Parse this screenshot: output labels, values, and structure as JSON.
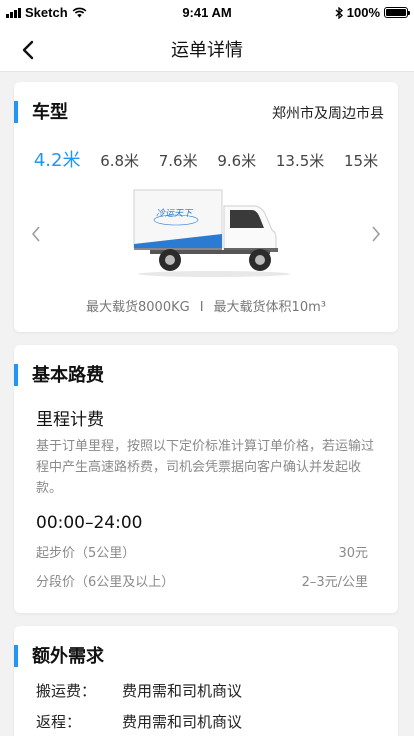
{
  "status_bar": {
    "carrier": "Sketch",
    "time": "9:41 AM",
    "battery": "100%"
  },
  "nav": {
    "title": "运单详情"
  },
  "vehicle_card": {
    "title": "车型",
    "region": "郑州市及周边市县",
    "tabs": [
      "4.2米",
      "6.8米",
      "7.6米",
      "9.6米",
      "13.5米",
      "15米"
    ],
    "active_tab": "4.2米",
    "truck_brand": "冷运天下",
    "max_load": "最大载货8000KG",
    "separator": "I",
    "max_volume": "最大载货体积10m³"
  },
  "fee_card": {
    "title": "基本路费",
    "mileage_title": "里程计费",
    "description": "基于订单里程，按照以下定价标准计算订单价格，若运输过程中产生高速路桥费，司机会凭票据向客户确认并发起收款。",
    "time_range": "00:00–24:00",
    "prices": [
      {
        "label": "起步价（5公里）",
        "value": "30元"
      },
      {
        "label": "分段价（6公里及以上）",
        "value": "2–3元/公里"
      }
    ]
  },
  "extra_card": {
    "title": "额外需求",
    "rows": [
      {
        "key": "搬运费：",
        "value": "费用需和司机商议"
      },
      {
        "key": "返程：",
        "value": "费用需和司机商议"
      }
    ]
  },
  "colors": {
    "accent": "#2196f3",
    "page_bg": "#f2f2f2"
  }
}
